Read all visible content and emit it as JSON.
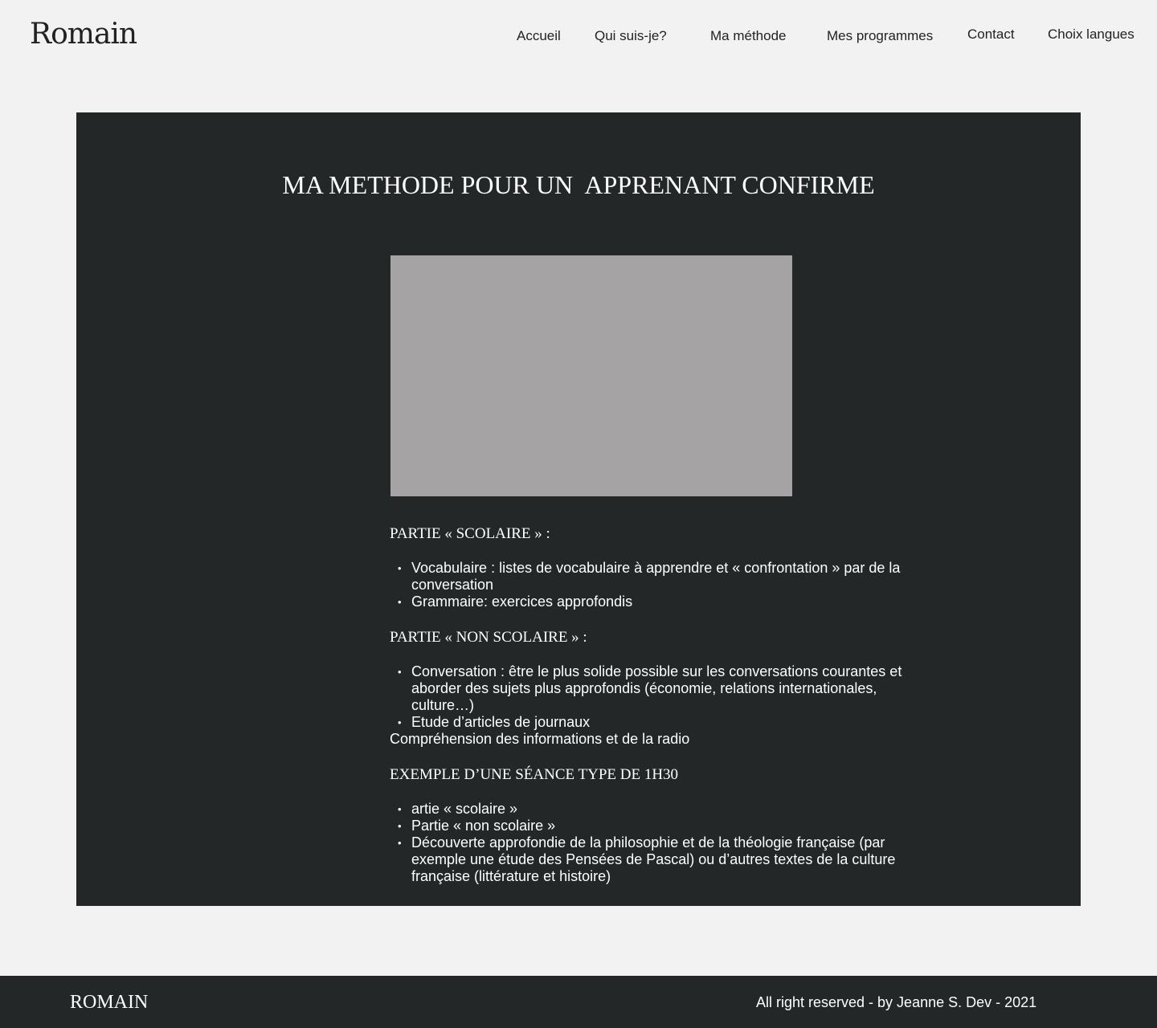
{
  "header": {
    "logo": "Romain",
    "nav": [
      "Accueil",
      "Qui suis-je?",
      "Ma méthode",
      "Mes programmes",
      "Contact",
      "Choix langues"
    ]
  },
  "main": {
    "title": "MA METHODE POUR UN  APPRENANT CONFIRME",
    "sections": [
      {
        "heading": "PARTIE « SCOLAIRE » :",
        "items": [
          "Vocabulaire : listes de vocabulaire à apprendre et « confrontation » par de la conversation",
          "Grammaire:  exercices approfondis"
        ]
      },
      {
        "heading": "PARTIE « NON SCOLAIRE » :",
        "items": [
          "Conversation : être le plus solide possible sur les conversations courantes et aborder des sujets plus approfondis (économie, relations internationales, culture…)",
          "Etude d’articles de journaux"
        ],
        "after": "Compréhension des informations et de la radio"
      },
      {
        "heading": "EXEMPLE D’UNE SÉANCE TYPE DE 1H30",
        "items": [
          "artie « scolaire »",
          "Partie « non scolaire »",
          "Découverte approfondie de la philosophie et de la théologie française (par exemple une étude des Pensées de Pascal) ou d’autres textes de la culture française (littérature et histoire)"
        ]
      }
    ]
  },
  "footer": {
    "logo": "ROMAIN",
    "copyright": "All right reserved - by Jeanne S. Dev - 2021"
  }
}
